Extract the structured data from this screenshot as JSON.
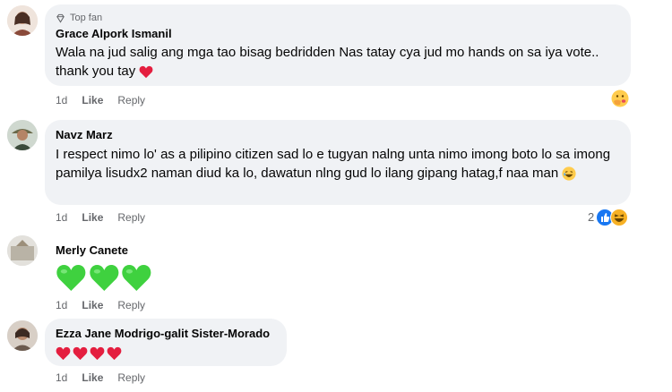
{
  "comments": [
    {
      "badge": "Top fan",
      "author": "Grace Alpork Ismanil",
      "text": "Wala na jud salig ang mga tao bisag bedridden Nas tatay cya jud mo hands on sa iya vote.. thank you tay",
      "time": "1d",
      "like": "Like",
      "reply": "Reply",
      "reaction_icon": "hand-over-mouth-emoji-icon"
    },
    {
      "author": "Navz Marz",
      "text": "I respect nimo lo' as a pilipino citizen sad lo e tugyan nalng unta nimo imong boto lo sa imong pamilya lisudx2 naman diud ka lo, dawatun nlng gud lo ilang gipang hatag,f naa man",
      "time": "1d",
      "like": "Like",
      "reply": "Reply",
      "reaction_count": "2",
      "reaction_icons": [
        "like-reaction-icon",
        "haha-reaction-icon"
      ]
    },
    {
      "author": "Merly Canete",
      "text": "",
      "emoji_row": [
        "green-heart-icon",
        "green-heart-icon",
        "green-heart-icon"
      ],
      "time": "1d",
      "like": "Like",
      "reply": "Reply"
    },
    {
      "author": "Ezza Jane Modrigo-galit Sister-Morado",
      "text": "",
      "emoji_row": [
        "red-heart-icon",
        "red-heart-icon",
        "red-heart-icon",
        "red-heart-icon"
      ],
      "time": "1d",
      "like": "Like",
      "reply": "Reply"
    }
  ],
  "colors": {
    "bubble": "#f0f2f5",
    "meta_text": "#65676b",
    "like_blue": "#1877f2",
    "heart_red": "#e41e3f",
    "heart_green": "#3fd13f"
  }
}
